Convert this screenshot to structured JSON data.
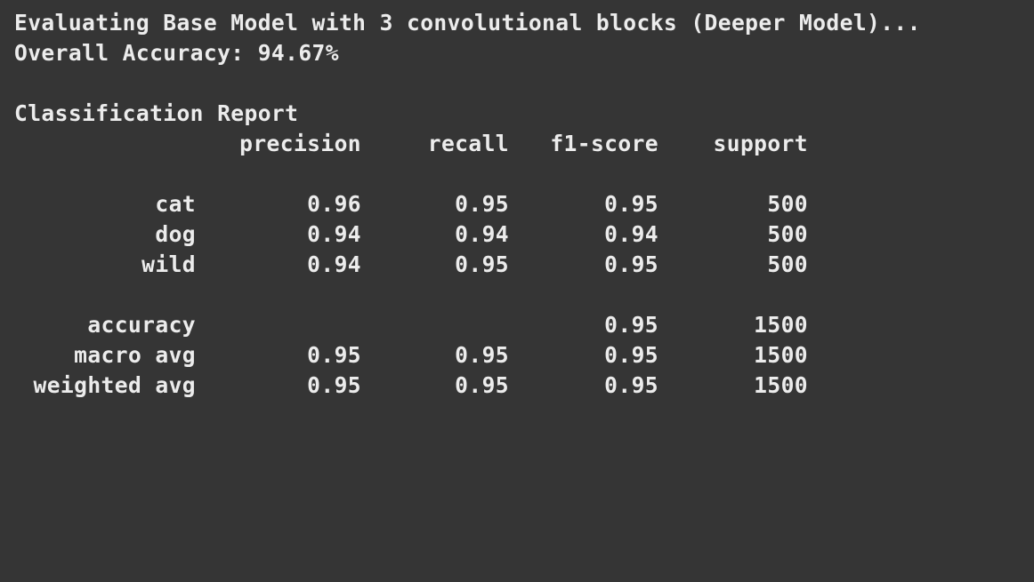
{
  "output": {
    "header_line": "Evaluating Base Model with 3 convolutional blocks (Deeper Model)...",
    "accuracy_line": "Overall Accuracy: 94.67%",
    "report_title": "Classification Report"
  },
  "report": {
    "columns": [
      "precision",
      "recall",
      "f1-score",
      "support"
    ],
    "classes": [
      {
        "label": "cat",
        "precision": "0.96",
        "recall": "0.95",
        "f1": "0.95",
        "support": "500"
      },
      {
        "label": "dog",
        "precision": "0.94",
        "recall": "0.94",
        "f1": "0.94",
        "support": "500"
      },
      {
        "label": "wild",
        "precision": "0.94",
        "recall": "0.95",
        "f1": "0.95",
        "support": "500"
      }
    ],
    "accuracy": {
      "label": "accuracy",
      "f1": "0.95",
      "support": "1500"
    },
    "averages": [
      {
        "label": "macro avg",
        "precision": "0.95",
        "recall": "0.95",
        "f1": "0.95",
        "support": "1500"
      },
      {
        "label": "weighted avg",
        "precision": "0.95",
        "recall": "0.95",
        "f1": "0.95",
        "support": "1500"
      }
    ]
  }
}
